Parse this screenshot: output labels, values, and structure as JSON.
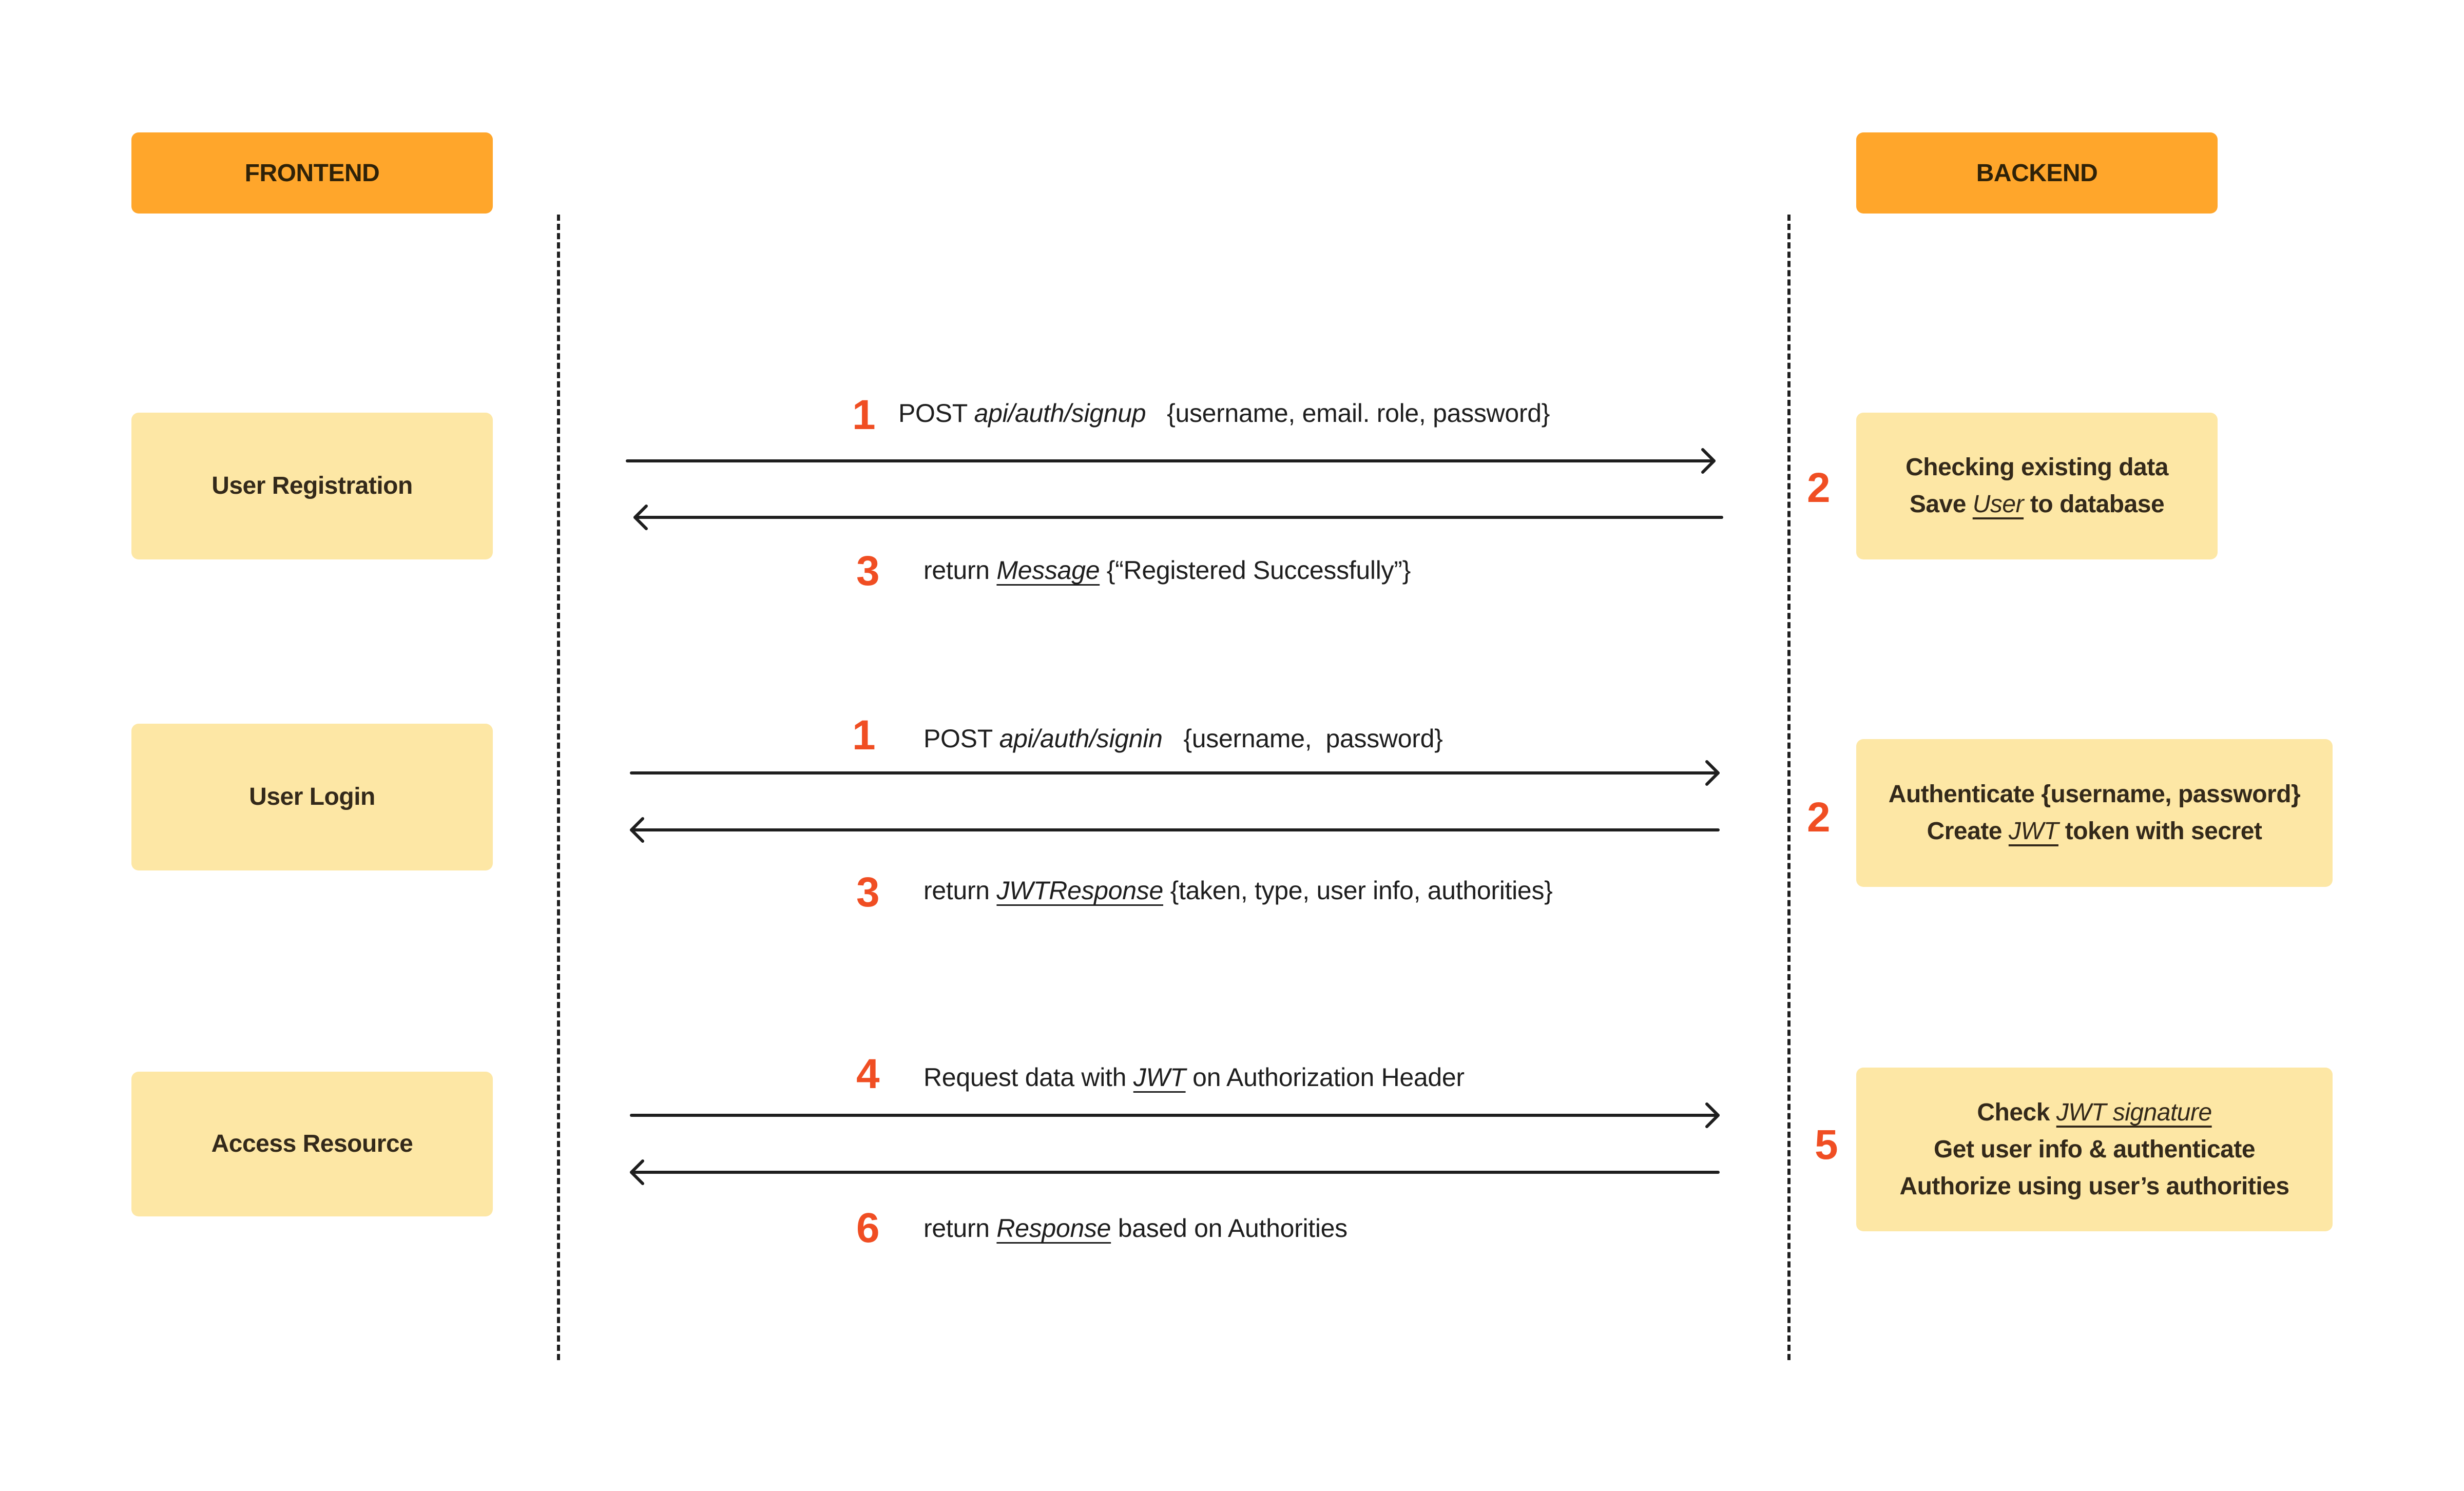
{
  "headers": {
    "frontend": "FRONTEND",
    "backend": "BACKEND"
  },
  "colors": {
    "header": "#ffa62b",
    "step_box": "#fde7a5",
    "step_number": "#f04e23",
    "line": "#1e1e1e"
  },
  "flows": [
    {
      "frontend_label": "User Registration",
      "request": {
        "step": "1",
        "prefix": "POST ",
        "path": "api/auth/signup",
        "suffix": "   {username, email. role, password}"
      },
      "backend": {
        "step": "2",
        "lines": [
          {
            "pre": "Checking existing data",
            "em": "",
            "post": ""
          },
          {
            "pre": "Save ",
            "em": "User",
            "post": " to database"
          }
        ]
      },
      "response": {
        "step": "3",
        "prefix": "return ",
        "em": "Message",
        "suffix": " {“Registered Successfully”}"
      }
    },
    {
      "frontend_label": "User Login",
      "request": {
        "step": "1",
        "prefix": "POST ",
        "path": "api/auth/signin",
        "suffix": "   {username,  password}"
      },
      "backend": {
        "step": "2",
        "lines": [
          {
            "pre": "Authenticate {username, password}",
            "em": "",
            "post": ""
          },
          {
            "pre": "Create ",
            "em": "JWT",
            "post": " token with secret"
          }
        ]
      },
      "response": {
        "step": "3",
        "prefix": "return ",
        "em": "JWTResponse",
        "suffix": " {taken, type, user info, authorities}"
      }
    },
    {
      "frontend_label": "Access Resource",
      "request": {
        "step": "4",
        "prefix": "Request data with ",
        "em": "JWT",
        "suffix": " on Authorization Header"
      },
      "backend": {
        "step": "5",
        "lines": [
          {
            "pre": "Check ",
            "em": "JWT signature",
            "post": ""
          },
          {
            "pre": "Get user info & authenticate",
            "em": "",
            "post": ""
          },
          {
            "pre": "Authorize using user’s authorities",
            "em": "",
            "post": ""
          }
        ]
      },
      "response": {
        "step": "6",
        "prefix": "return ",
        "em": "Response",
        "suffix": " based on Authorities"
      }
    }
  ]
}
